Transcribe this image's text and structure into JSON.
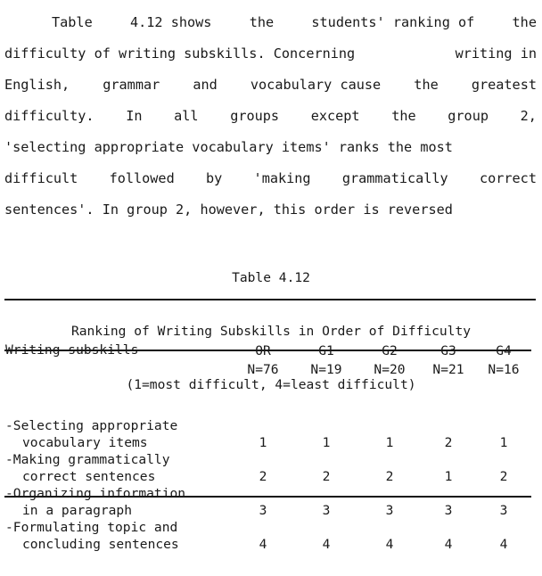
{
  "document": {
    "paragraph": {
      "lines": [
        {
          "indent": true,
          "words": [
            "Table",
            "4.12 shows",
            "the",
            "students' ranking of",
            "the"
          ]
        },
        {
          "indent": false,
          "words": [
            "difficulty of writing subskills. Concerning",
            "writing in"
          ]
        },
        {
          "indent": false,
          "words": [
            "English,",
            "grammar",
            "and",
            "vocabulary cause",
            "the",
            "greatest"
          ]
        },
        {
          "indent": false,
          "words": [
            "difficulty.",
            "In",
            "all",
            "groups",
            "except",
            "the",
            "group",
            "2,"
          ]
        },
        {
          "indent": false,
          "words": [
            "'selecting appropriate vocabulary items' ranks the most"
          ]
        },
        {
          "indent": false,
          "words": [
            "difficult",
            "followed",
            "by",
            "'making",
            "grammatically",
            "correct"
          ]
        },
        {
          "indent": false,
          "words": [
            "sentences'. In group 2, however, this order is reversed"
          ]
        }
      ]
    },
    "table": {
      "caption": {
        "number_line": "Table 4.12",
        "title_line": "Ranking of Writing Subskills in Order of Difficulty",
        "legend_line": "(1=most difficult, 4=least difficult)"
      },
      "stub_header": "Writing subskills",
      "columns": [
        {
          "abbr": "OR",
          "n": "N=76"
        },
        {
          "abbr": "G1",
          "n": "N=19"
        },
        {
          "abbr": "G2",
          "n": "N=20"
        },
        {
          "abbr": "G3",
          "n": "N=21"
        },
        {
          "abbr": "G4",
          "n": "N=16"
        }
      ],
      "rows": [
        {
          "label_line_1": "-Selecting appropriate",
          "label_line_2": "vocabulary items",
          "values": [
            "1",
            "1",
            "1",
            "2",
            "1"
          ]
        },
        {
          "label_line_1": "-Making grammatically",
          "label_line_2": "correct sentences",
          "values": [
            "2",
            "2",
            "2",
            "1",
            "2"
          ]
        },
        {
          "label_line_1": "-Organizing information",
          "label_line_2": "in a paragraph",
          "values": [
            "3",
            "3",
            "3",
            "3",
            "3"
          ]
        },
        {
          "label_line_1": "-Formulating topic and",
          "label_line_2": "concluding sentences",
          "values": [
            "4",
            "4",
            "4",
            "4",
            "4"
          ]
        }
      ]
    }
  }
}
